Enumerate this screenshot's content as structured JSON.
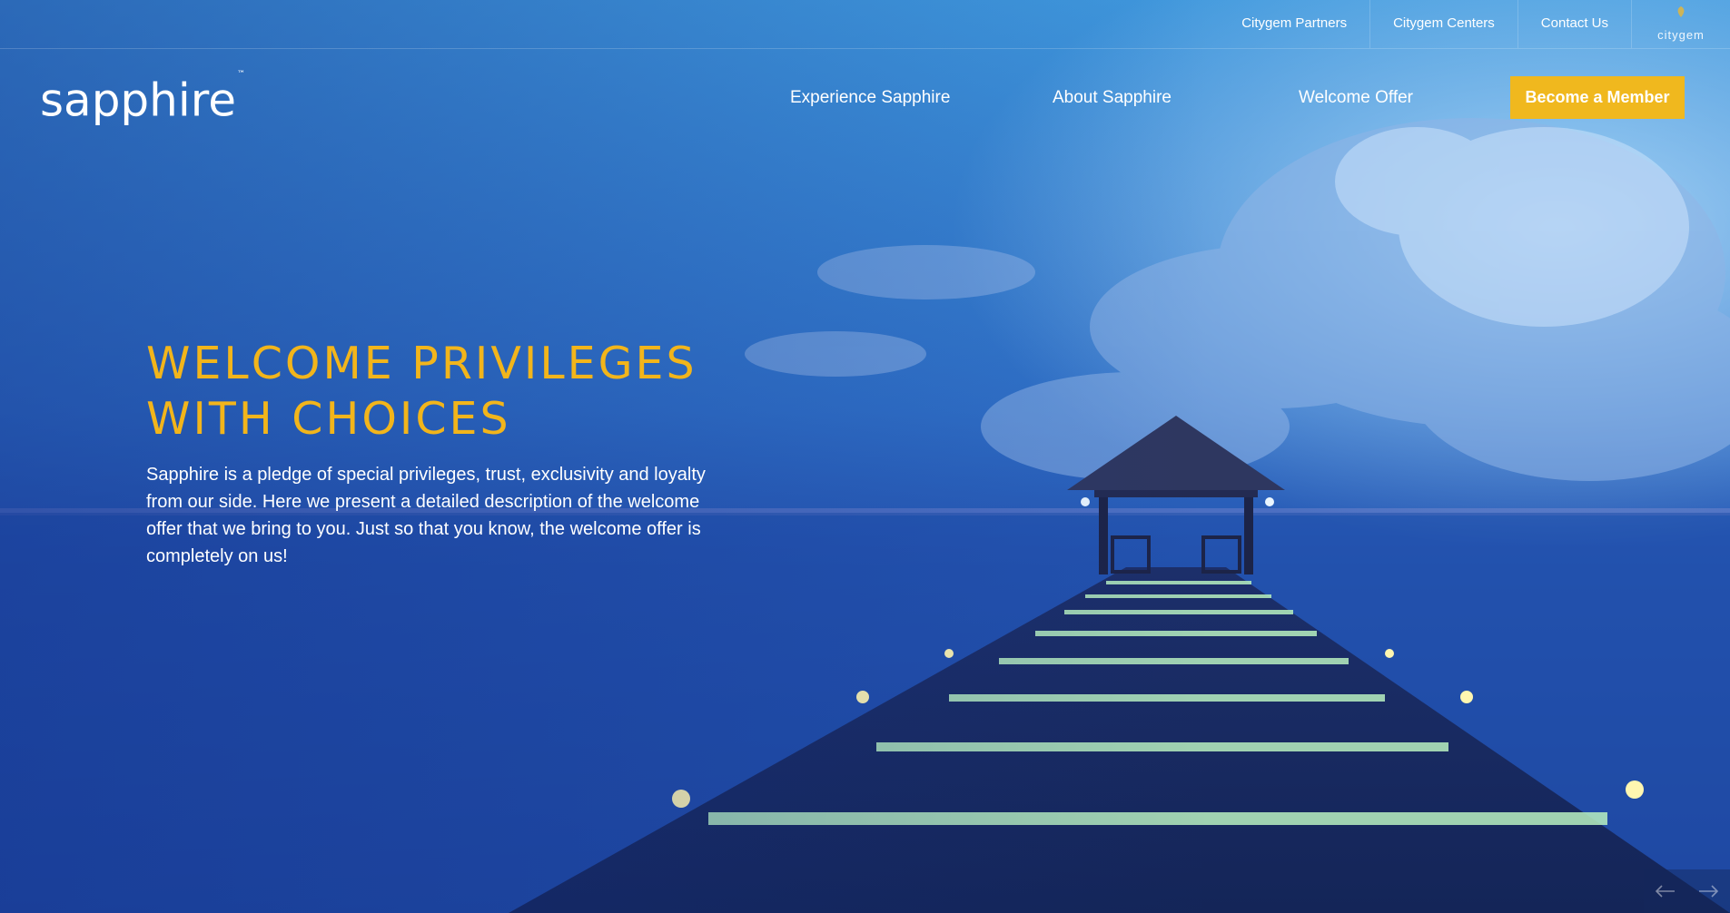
{
  "utility_nav": {
    "links": [
      "Citygem Partners",
      "Citygem Centers",
      "Contact Us"
    ],
    "logo_text": "citygem"
  },
  "brand": {
    "name": "sapphire",
    "trademark": "™"
  },
  "main_nav": {
    "items": [
      "Experience Sapphire",
      "About Sapphire",
      "Welcome Offer"
    ],
    "cta_label": "Become a Member"
  },
  "hero": {
    "title_lines": [
      "WELCOME PRIVILEGES",
      "WITH CHOICES"
    ],
    "body": "Sapphire is a pledge of special privileges, trust, exclusivity and loyalty from our side. Here we present a detailed description of the welcome offer that we bring to you. Just so that you know, the welcome offer is completely on us!",
    "background": "blue-dusk-ocean-pier-photo"
  },
  "slider": {
    "prev_icon": "arrow-left-icon",
    "next_icon": "arrow-right-icon"
  },
  "colors": {
    "accent": "#f0b81e",
    "title": "#f2b51b",
    "sky": "#3a8fd8",
    "sea": "#1e4aa8"
  }
}
